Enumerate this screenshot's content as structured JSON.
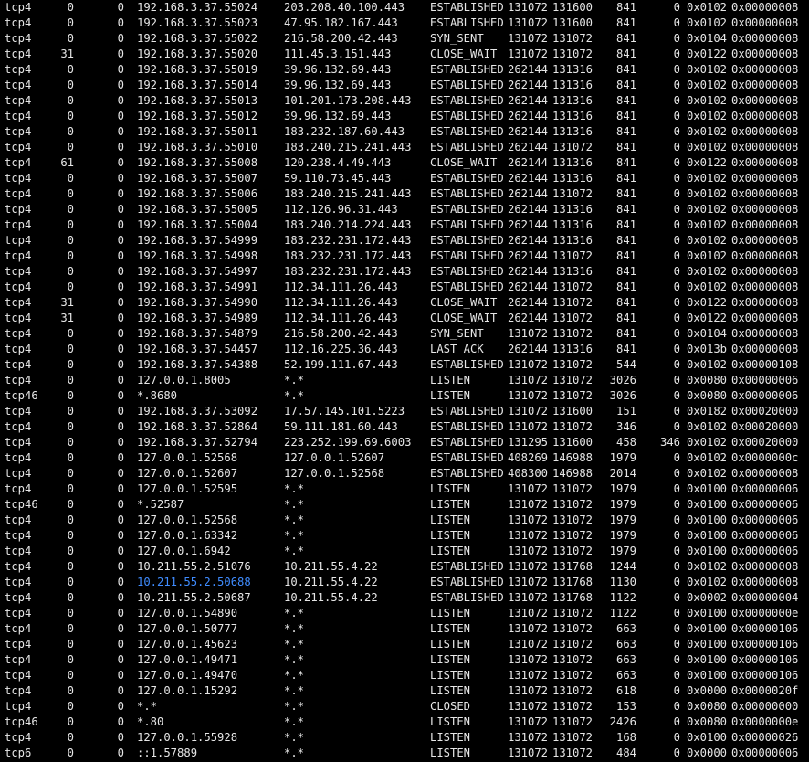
{
  "terminal": {
    "link_color": "#3f8cff",
    "rows": [
      [
        "tcp4",
        "0",
        "0",
        "192.168.3.37.55024",
        "203.208.40.100.443",
        "ESTABLISHED",
        "131072",
        "131600",
        "841",
        "0",
        "0x0102",
        "0x00000008"
      ],
      [
        "tcp4",
        "0",
        "0",
        "192.168.3.37.55023",
        "47.95.182.167.443",
        "ESTABLISHED",
        "131072",
        "131600",
        "841",
        "0",
        "0x0102",
        "0x00000008"
      ],
      [
        "tcp4",
        "0",
        "0",
        "192.168.3.37.55022",
        "216.58.200.42.443",
        "SYN_SENT",
        "131072",
        "131072",
        "841",
        "0",
        "0x0104",
        "0x00000008"
      ],
      [
        "tcp4",
        "31",
        "0",
        "192.168.3.37.55020",
        "111.45.3.151.443",
        "CLOSE_WAIT",
        "131072",
        "131072",
        "841",
        "0",
        "0x0122",
        "0x00000008"
      ],
      [
        "tcp4",
        "0",
        "0",
        "192.168.3.37.55019",
        "39.96.132.69.443",
        "ESTABLISHED",
        "262144",
        "131316",
        "841",
        "0",
        "0x0102",
        "0x00000008"
      ],
      [
        "tcp4",
        "0",
        "0",
        "192.168.3.37.55014",
        "39.96.132.69.443",
        "ESTABLISHED",
        "262144",
        "131316",
        "841",
        "0",
        "0x0102",
        "0x00000008"
      ],
      [
        "tcp4",
        "0",
        "0",
        "192.168.3.37.55013",
        "101.201.173.208.443",
        "ESTABLISHED",
        "262144",
        "131316",
        "841",
        "0",
        "0x0102",
        "0x00000008"
      ],
      [
        "tcp4",
        "0",
        "0",
        "192.168.3.37.55012",
        "39.96.132.69.443",
        "ESTABLISHED",
        "262144",
        "131316",
        "841",
        "0",
        "0x0102",
        "0x00000008"
      ],
      [
        "tcp4",
        "0",
        "0",
        "192.168.3.37.55011",
        "183.232.187.60.443",
        "ESTABLISHED",
        "262144",
        "131316",
        "841",
        "0",
        "0x0102",
        "0x00000008"
      ],
      [
        "tcp4",
        "0",
        "0",
        "192.168.3.37.55010",
        "183.240.215.241.443",
        "ESTABLISHED",
        "262144",
        "131072",
        "841",
        "0",
        "0x0102",
        "0x00000008"
      ],
      [
        "tcp4",
        "61",
        "0",
        "192.168.3.37.55008",
        "120.238.4.49.443",
        "CLOSE_WAIT",
        "262144",
        "131316",
        "841",
        "0",
        "0x0122",
        "0x00000008"
      ],
      [
        "tcp4",
        "0",
        "0",
        "192.168.3.37.55007",
        "59.110.73.45.443",
        "ESTABLISHED",
        "262144",
        "131316",
        "841",
        "0",
        "0x0102",
        "0x00000008"
      ],
      [
        "tcp4",
        "0",
        "0",
        "192.168.3.37.55006",
        "183.240.215.241.443",
        "ESTABLISHED",
        "262144",
        "131072",
        "841",
        "0",
        "0x0102",
        "0x00000008"
      ],
      [
        "tcp4",
        "0",
        "0",
        "192.168.3.37.55005",
        "112.126.96.31.443",
        "ESTABLISHED",
        "262144",
        "131316",
        "841",
        "0",
        "0x0102",
        "0x00000008"
      ],
      [
        "tcp4",
        "0",
        "0",
        "192.168.3.37.55004",
        "183.240.214.224.443",
        "ESTABLISHED",
        "262144",
        "131316",
        "841",
        "0",
        "0x0102",
        "0x00000008"
      ],
      [
        "tcp4",
        "0",
        "0",
        "192.168.3.37.54999",
        "183.232.231.172.443",
        "ESTABLISHED",
        "262144",
        "131316",
        "841",
        "0",
        "0x0102",
        "0x00000008"
      ],
      [
        "tcp4",
        "0",
        "0",
        "192.168.3.37.54998",
        "183.232.231.172.443",
        "ESTABLISHED",
        "262144",
        "131072",
        "841",
        "0",
        "0x0102",
        "0x00000008"
      ],
      [
        "tcp4",
        "0",
        "0",
        "192.168.3.37.54997",
        "183.232.231.172.443",
        "ESTABLISHED",
        "262144",
        "131316",
        "841",
        "0",
        "0x0102",
        "0x00000008"
      ],
      [
        "tcp4",
        "0",
        "0",
        "192.168.3.37.54991",
        "112.34.111.26.443",
        "ESTABLISHED",
        "262144",
        "131072",
        "841",
        "0",
        "0x0102",
        "0x00000008"
      ],
      [
        "tcp4",
        "31",
        "0",
        "192.168.3.37.54990",
        "112.34.111.26.443",
        "CLOSE_WAIT",
        "262144",
        "131072",
        "841",
        "0",
        "0x0122",
        "0x00000008"
      ],
      [
        "tcp4",
        "31",
        "0",
        "192.168.3.37.54989",
        "112.34.111.26.443",
        "CLOSE_WAIT",
        "262144",
        "131072",
        "841",
        "0",
        "0x0122",
        "0x00000008"
      ],
      [
        "tcp4",
        "0",
        "0",
        "192.168.3.37.54879",
        "216.58.200.42.443",
        "SYN_SENT",
        "131072",
        "131072",
        "841",
        "0",
        "0x0104",
        "0x00000008"
      ],
      [
        "tcp4",
        "0",
        "0",
        "192.168.3.37.54457",
        "112.16.225.36.443",
        "LAST_ACK",
        "262144",
        "131316",
        "841",
        "0",
        "0x013b",
        "0x00000008"
      ],
      [
        "tcp4",
        "0",
        "0",
        "192.168.3.37.54388",
        "52.199.111.67.443",
        "ESTABLISHED",
        "131072",
        "131072",
        "544",
        "0",
        "0x0102",
        "0x00000108"
      ],
      [
        "tcp4",
        "0",
        "0",
        "127.0.0.1.8005",
        "*.*",
        "LISTEN",
        "131072",
        "131072",
        "3026",
        "0",
        "0x0080",
        "0x00000006"
      ],
      [
        "tcp46",
        "0",
        "0",
        "*.8680",
        "*.*",
        "LISTEN",
        "131072",
        "131072",
        "3026",
        "0",
        "0x0080",
        "0x00000006"
      ],
      [
        "tcp4",
        "0",
        "0",
        "192.168.3.37.53092",
        "17.57.145.101.5223",
        "ESTABLISHED",
        "131072",
        "131600",
        "151",
        "0",
        "0x0182",
        "0x00020000"
      ],
      [
        "tcp4",
        "0",
        "0",
        "192.168.3.37.52864",
        "59.111.181.60.443",
        "ESTABLISHED",
        "131072",
        "131072",
        "346",
        "0",
        "0x0102",
        "0x00020000"
      ],
      [
        "tcp4",
        "0",
        "0",
        "192.168.3.37.52794",
        "223.252.199.69.6003",
        "ESTABLISHED",
        "131295",
        "131600",
        "458",
        "346",
        "0x0102",
        "0x00020000"
      ],
      [
        "tcp4",
        "0",
        "0",
        "127.0.0.1.52568",
        "127.0.0.1.52607",
        "ESTABLISHED",
        "408269",
        "146988",
        "1979",
        "0",
        "0x0102",
        "0x0000000c"
      ],
      [
        "tcp4",
        "0",
        "0",
        "127.0.0.1.52607",
        "127.0.0.1.52568",
        "ESTABLISHED",
        "408300",
        "146988",
        "2014",
        "0",
        "0x0102",
        "0x00000008"
      ],
      [
        "tcp4",
        "0",
        "0",
        "127.0.0.1.52595",
        "*.*",
        "LISTEN",
        "131072",
        "131072",
        "1979",
        "0",
        "0x0100",
        "0x00000006"
      ],
      [
        "tcp46",
        "0",
        "0",
        "*.52587",
        "*.*",
        "LISTEN",
        "131072",
        "131072",
        "1979",
        "0",
        "0x0100",
        "0x00000006"
      ],
      [
        "tcp4",
        "0",
        "0",
        "127.0.0.1.52568",
        "*.*",
        "LISTEN",
        "131072",
        "131072",
        "1979",
        "0",
        "0x0100",
        "0x00000006"
      ],
      [
        "tcp4",
        "0",
        "0",
        "127.0.0.1.63342",
        "*.*",
        "LISTEN",
        "131072",
        "131072",
        "1979",
        "0",
        "0x0100",
        "0x00000006"
      ],
      [
        "tcp4",
        "0",
        "0",
        "127.0.0.1.6942",
        "*.*",
        "LISTEN",
        "131072",
        "131072",
        "1979",
        "0",
        "0x0100",
        "0x00000006"
      ],
      [
        "tcp4",
        "0",
        "0",
        "10.211.55.2.51076",
        "10.211.55.4.22",
        "ESTABLISHED",
        "131072",
        "131768",
        "1244",
        "0",
        "0x0102",
        "0x00000008"
      ],
      [
        "tcp4",
        "0",
        "0",
        "10.211.55.2.50688",
        "10.211.55.4.22",
        "ESTABLISHED",
        "131072",
        "131768",
        "1130",
        "0",
        "0x0102",
        "0x00000008"
      ],
      [
        "tcp4",
        "0",
        "0",
        "10.211.55.2.50687",
        "10.211.55.4.22",
        "ESTABLISHED",
        "131072",
        "131768",
        "1122",
        "0",
        "0x0002",
        "0x00000004"
      ],
      [
        "tcp4",
        "0",
        "0",
        "127.0.0.1.54890",
        "*.*",
        "LISTEN",
        "131072",
        "131072",
        "1122",
        "0",
        "0x0100",
        "0x0000000e"
      ],
      [
        "tcp4",
        "0",
        "0",
        "127.0.0.1.50777",
        "*.*",
        "LISTEN",
        "131072",
        "131072",
        "663",
        "0",
        "0x0100",
        "0x00000106"
      ],
      [
        "tcp4",
        "0",
        "0",
        "127.0.0.1.45623",
        "*.*",
        "LISTEN",
        "131072",
        "131072",
        "663",
        "0",
        "0x0100",
        "0x00000106"
      ],
      [
        "tcp4",
        "0",
        "0",
        "127.0.0.1.49471",
        "*.*",
        "LISTEN",
        "131072",
        "131072",
        "663",
        "0",
        "0x0100",
        "0x00000106"
      ],
      [
        "tcp4",
        "0",
        "0",
        "127.0.0.1.49470",
        "*.*",
        "LISTEN",
        "131072",
        "131072",
        "663",
        "0",
        "0x0100",
        "0x00000106"
      ],
      [
        "tcp4",
        "0",
        "0",
        "127.0.0.1.15292",
        "*.*",
        "LISTEN",
        "131072",
        "131072",
        "618",
        "0",
        "0x0000",
        "0x0000020f"
      ],
      [
        "tcp4",
        "0",
        "0",
        "*.*",
        "*.*",
        "CLOSED",
        "131072",
        "131072",
        "153",
        "0",
        "0x0080",
        "0x00000000"
      ],
      [
        "tcp46",
        "0",
        "0",
        "*.80",
        "*.*",
        "LISTEN",
        "131072",
        "131072",
        "2426",
        "0",
        "0x0080",
        "0x0000000e"
      ],
      [
        "tcp4",
        "0",
        "0",
        "127.0.0.1.55928",
        "*.*",
        "LISTEN",
        "131072",
        "131072",
        "168",
        "0",
        "0x0100",
        "0x00000026"
      ],
      [
        "tcp6",
        "0",
        "0",
        "::1.57889",
        "*.*",
        "LISTEN",
        "131072",
        "131072",
        "484",
        "0",
        "0x0000",
        "0x00000006"
      ]
    ],
    "highlighted_cell": "10.211.55.2.50688"
  }
}
